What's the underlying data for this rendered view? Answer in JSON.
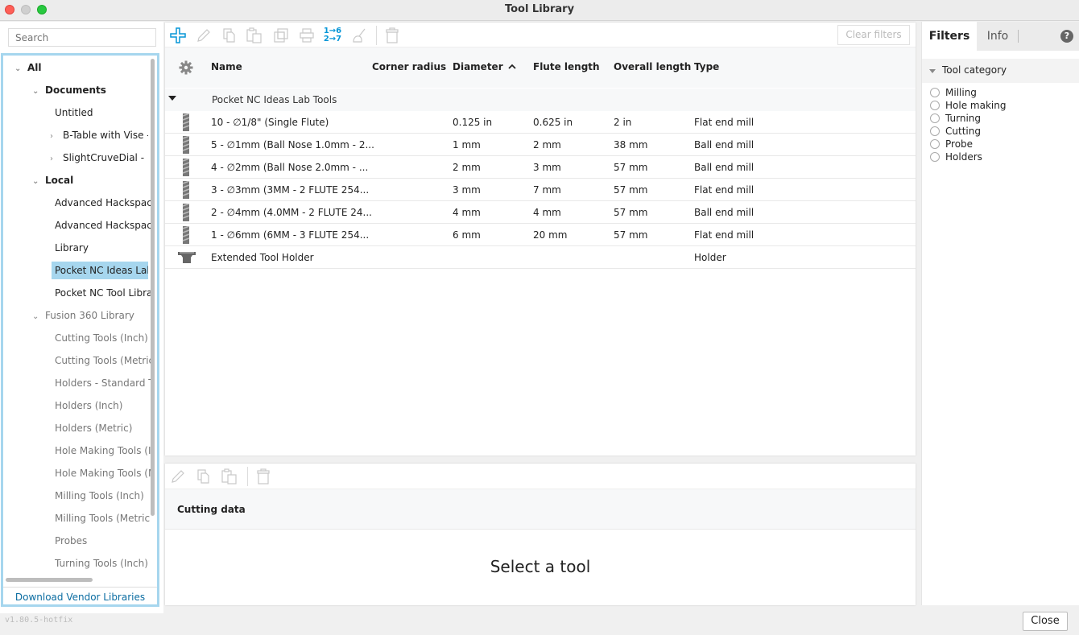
{
  "window": {
    "title": "Tool Library"
  },
  "sidebar": {
    "search_placeholder": "Search",
    "tree": [
      {
        "label": "All",
        "level": 0,
        "expander": "expanded",
        "style": "bold"
      },
      {
        "label": "Documents",
        "level": 1,
        "expander": "expanded",
        "style": "bold"
      },
      {
        "label": "Untitled",
        "level": 2,
        "expander": "none",
        "style": "dark"
      },
      {
        "label": "B-Table with Vise - ",
        "level": 2,
        "expander": "collapsed",
        "style": "dark"
      },
      {
        "label": "SlightCruveDial - In",
        "level": 2,
        "expander": "collapsed",
        "style": "dark"
      },
      {
        "label": "Local",
        "level": 1,
        "expander": "expanded",
        "style": "bold"
      },
      {
        "label": "Advanced Hackspace",
        "level": 2,
        "expander": "none",
        "style": "dark"
      },
      {
        "label": "Advanced Hackspace",
        "level": 2,
        "expander": "none",
        "style": "dark"
      },
      {
        "label": "Library",
        "level": 2,
        "expander": "none",
        "style": "dark"
      },
      {
        "label": "Pocket NC Ideas Lab",
        "level": 2,
        "expander": "none",
        "style": "dark",
        "selected": true
      },
      {
        "label": "Pocket NC Tool Librar",
        "level": 2,
        "expander": "none",
        "style": "dark"
      },
      {
        "label": "Fusion 360 Library",
        "level": 1,
        "expander": "expanded",
        "style": "gray"
      },
      {
        "label": "Cutting Tools (Inch)",
        "level": 2,
        "expander": "none",
        "style": "gray"
      },
      {
        "label": "Cutting Tools (Metric",
        "level": 2,
        "expander": "none",
        "style": "gray"
      },
      {
        "label": "Holders - Standard T",
        "level": 2,
        "expander": "none",
        "style": "gray"
      },
      {
        "label": "Holders (Inch)",
        "level": 2,
        "expander": "none",
        "style": "gray"
      },
      {
        "label": "Holders (Metric)",
        "level": 2,
        "expander": "none",
        "style": "gray"
      },
      {
        "label": "Hole Making Tools (I",
        "level": 2,
        "expander": "none",
        "style": "gray"
      },
      {
        "label": "Hole Making Tools (M",
        "level": 2,
        "expander": "none",
        "style": "gray"
      },
      {
        "label": "Milling Tools (Inch)",
        "level": 2,
        "expander": "none",
        "style": "gray"
      },
      {
        "label": "Milling Tools (Metric",
        "level": 2,
        "expander": "none",
        "style": "gray"
      },
      {
        "label": "Probes",
        "level": 2,
        "expander": "none",
        "style": "gray"
      },
      {
        "label": "Turning Tools (Inch)",
        "level": 2,
        "expander": "none",
        "style": "gray"
      }
    ],
    "download_link": "Download Vendor Libraries"
  },
  "toolbar": {
    "icons": [
      "add-icon",
      "edit-icon",
      "copy-icon",
      "paste-icon",
      "duplicate-icon",
      "print-icon",
      "renumber-icon",
      "cleanup-icon",
      "delete-icon"
    ],
    "renumber_top": "1→6",
    "renumber_bottom": "2→7",
    "clear_filters": "Clear filters",
    "accent_color": "#0696d7"
  },
  "table": {
    "columns": [
      {
        "key": "name",
        "label": "Name"
      },
      {
        "key": "corner_radius",
        "label": "Corner radius"
      },
      {
        "key": "diameter",
        "label": "Diameter",
        "sort": "ascending"
      },
      {
        "key": "flute_length",
        "label": "Flute length"
      },
      {
        "key": "overall_length",
        "label": "Overall length"
      },
      {
        "key": "type",
        "label": "Type"
      }
    ],
    "group_label": "Pocket NC Ideas Lab Tools",
    "rows": [
      {
        "icon": "endmill-icon",
        "name": "10 - ∅1/8\" (Single Flute)",
        "corner_radius": "",
        "diameter": "0.125 in",
        "flute_length": "0.625 in",
        "overall_length": "2 in",
        "type": "Flat end mill"
      },
      {
        "icon": "endmill-icon",
        "name": "5 - ∅1mm (Ball Nose 1.0mm - 2...",
        "corner_radius": "",
        "diameter": "1 mm",
        "flute_length": "2 mm",
        "overall_length": "38 mm",
        "type": "Ball end mill"
      },
      {
        "icon": "endmill-icon",
        "name": "4 - ∅2mm (Ball Nose 2.0mm - ...",
        "corner_radius": "",
        "diameter": "2 mm",
        "flute_length": "3 mm",
        "overall_length": "57 mm",
        "type": "Ball end mill"
      },
      {
        "icon": "endmill-icon",
        "name": "3 - ∅3mm (3MM - 2 FLUTE 254...",
        "corner_radius": "",
        "diameter": "3 mm",
        "flute_length": "7 mm",
        "overall_length": "57 mm",
        "type": "Flat end mill"
      },
      {
        "icon": "endmill-icon",
        "name": "2 - ∅4mm (4.0MM - 2 FLUTE 24...",
        "corner_radius": "",
        "diameter": "4 mm",
        "flute_length": "4 mm",
        "overall_length": "57 mm",
        "type": "Ball end mill"
      },
      {
        "icon": "endmill-icon",
        "name": "1 - ∅6mm (6MM - 3 FLUTE 254...",
        "corner_radius": "",
        "diameter": "6 mm",
        "flute_length": "20 mm",
        "overall_length": "57 mm",
        "type": "Flat end mill"
      },
      {
        "icon": "holder-icon",
        "name": "Extended Tool Holder",
        "corner_radius": "",
        "diameter": "",
        "flute_length": "",
        "overall_length": "",
        "type": "Holder"
      }
    ]
  },
  "detail": {
    "header": "Cutting data",
    "empty_message": "Select a tool"
  },
  "filters": {
    "tabs": [
      "Filters",
      "Info"
    ],
    "active_tab": "Filters",
    "help": "?",
    "category_label": "Tool category",
    "categories": [
      "Milling",
      "Hole making",
      "Turning",
      "Cutting",
      "Probe",
      "Holders"
    ]
  },
  "footer": {
    "version": "v1.80.5-hotfix",
    "close_label": "Close"
  }
}
